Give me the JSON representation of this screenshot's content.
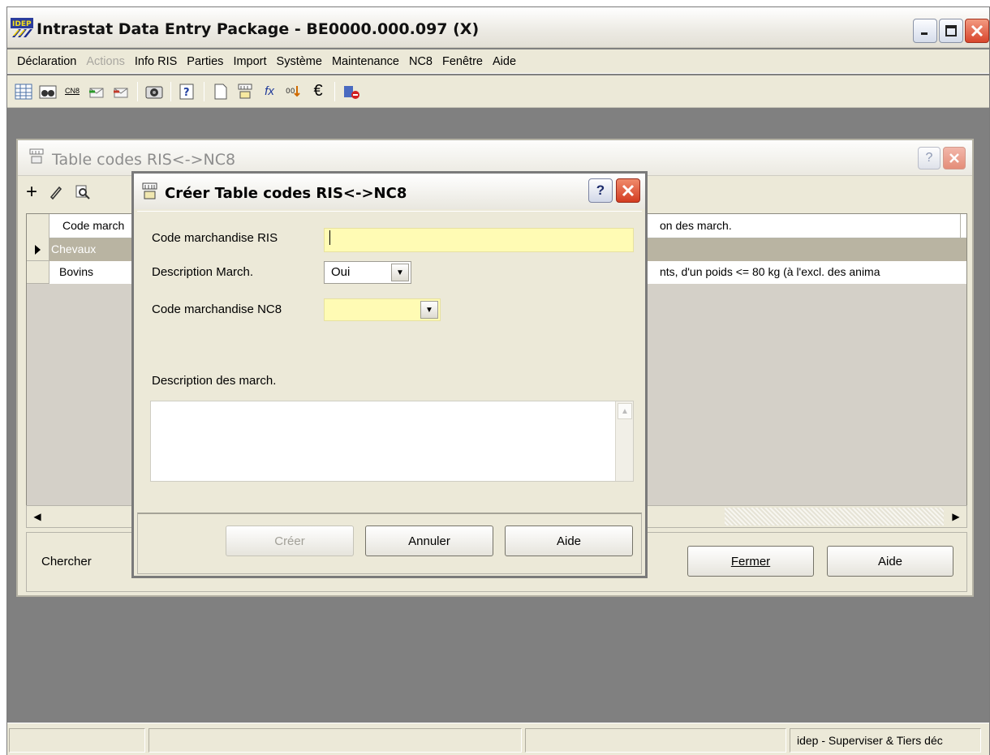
{
  "app": {
    "title": "Intrastat Data Entry Package - BE0000.000.097 (X)",
    "icon_text": "IDEP"
  },
  "menu": [
    {
      "label": "Déclaration",
      "disabled": false
    },
    {
      "label": "Actions",
      "disabled": true
    },
    {
      "label": "Info RIS",
      "disabled": false
    },
    {
      "label": "Parties",
      "disabled": false
    },
    {
      "label": "Import",
      "disabled": false
    },
    {
      "label": "Système",
      "disabled": false
    },
    {
      "label": "Maintenance",
      "disabled": false
    },
    {
      "label": "NC8",
      "disabled": false
    },
    {
      "label": "Fenêtre",
      "disabled": false
    },
    {
      "label": "Aide",
      "disabled": false
    }
  ],
  "toolbar": {
    "cn8_line1": "CN8",
    "cn8_line2": "NC8",
    "fx": "fx",
    "euro": "€"
  },
  "child_window": {
    "title": "Table codes RIS<->NC8",
    "columns": [
      "Code march",
      "on des march."
    ],
    "rows": [
      {
        "code": "Chevaux",
        "desc": ""
      },
      {
        "code": "Bovins",
        "desc": "nts, d'un poids <= 80 kg (à l'excl. des anima"
      }
    ],
    "search_label": "Chercher",
    "close_button": "Fermer",
    "help_button": "Aide"
  },
  "dialog": {
    "title": "Créer Table codes RIS<->NC8",
    "code_ris_label": "Code marchandise RIS",
    "code_ris_value": "",
    "desc_march_label": "Description March.",
    "desc_march_value": "Oui",
    "code_nc8_label": "Code marchandise NC8",
    "code_nc8_value": "",
    "desc_label": "Description des march.",
    "create_button": "Créer",
    "cancel_button": "Annuler",
    "help_button": "Aide",
    "help_icon_text": "?"
  },
  "statusbar": {
    "right_text": "idep - Superviser & Tiers déc"
  }
}
